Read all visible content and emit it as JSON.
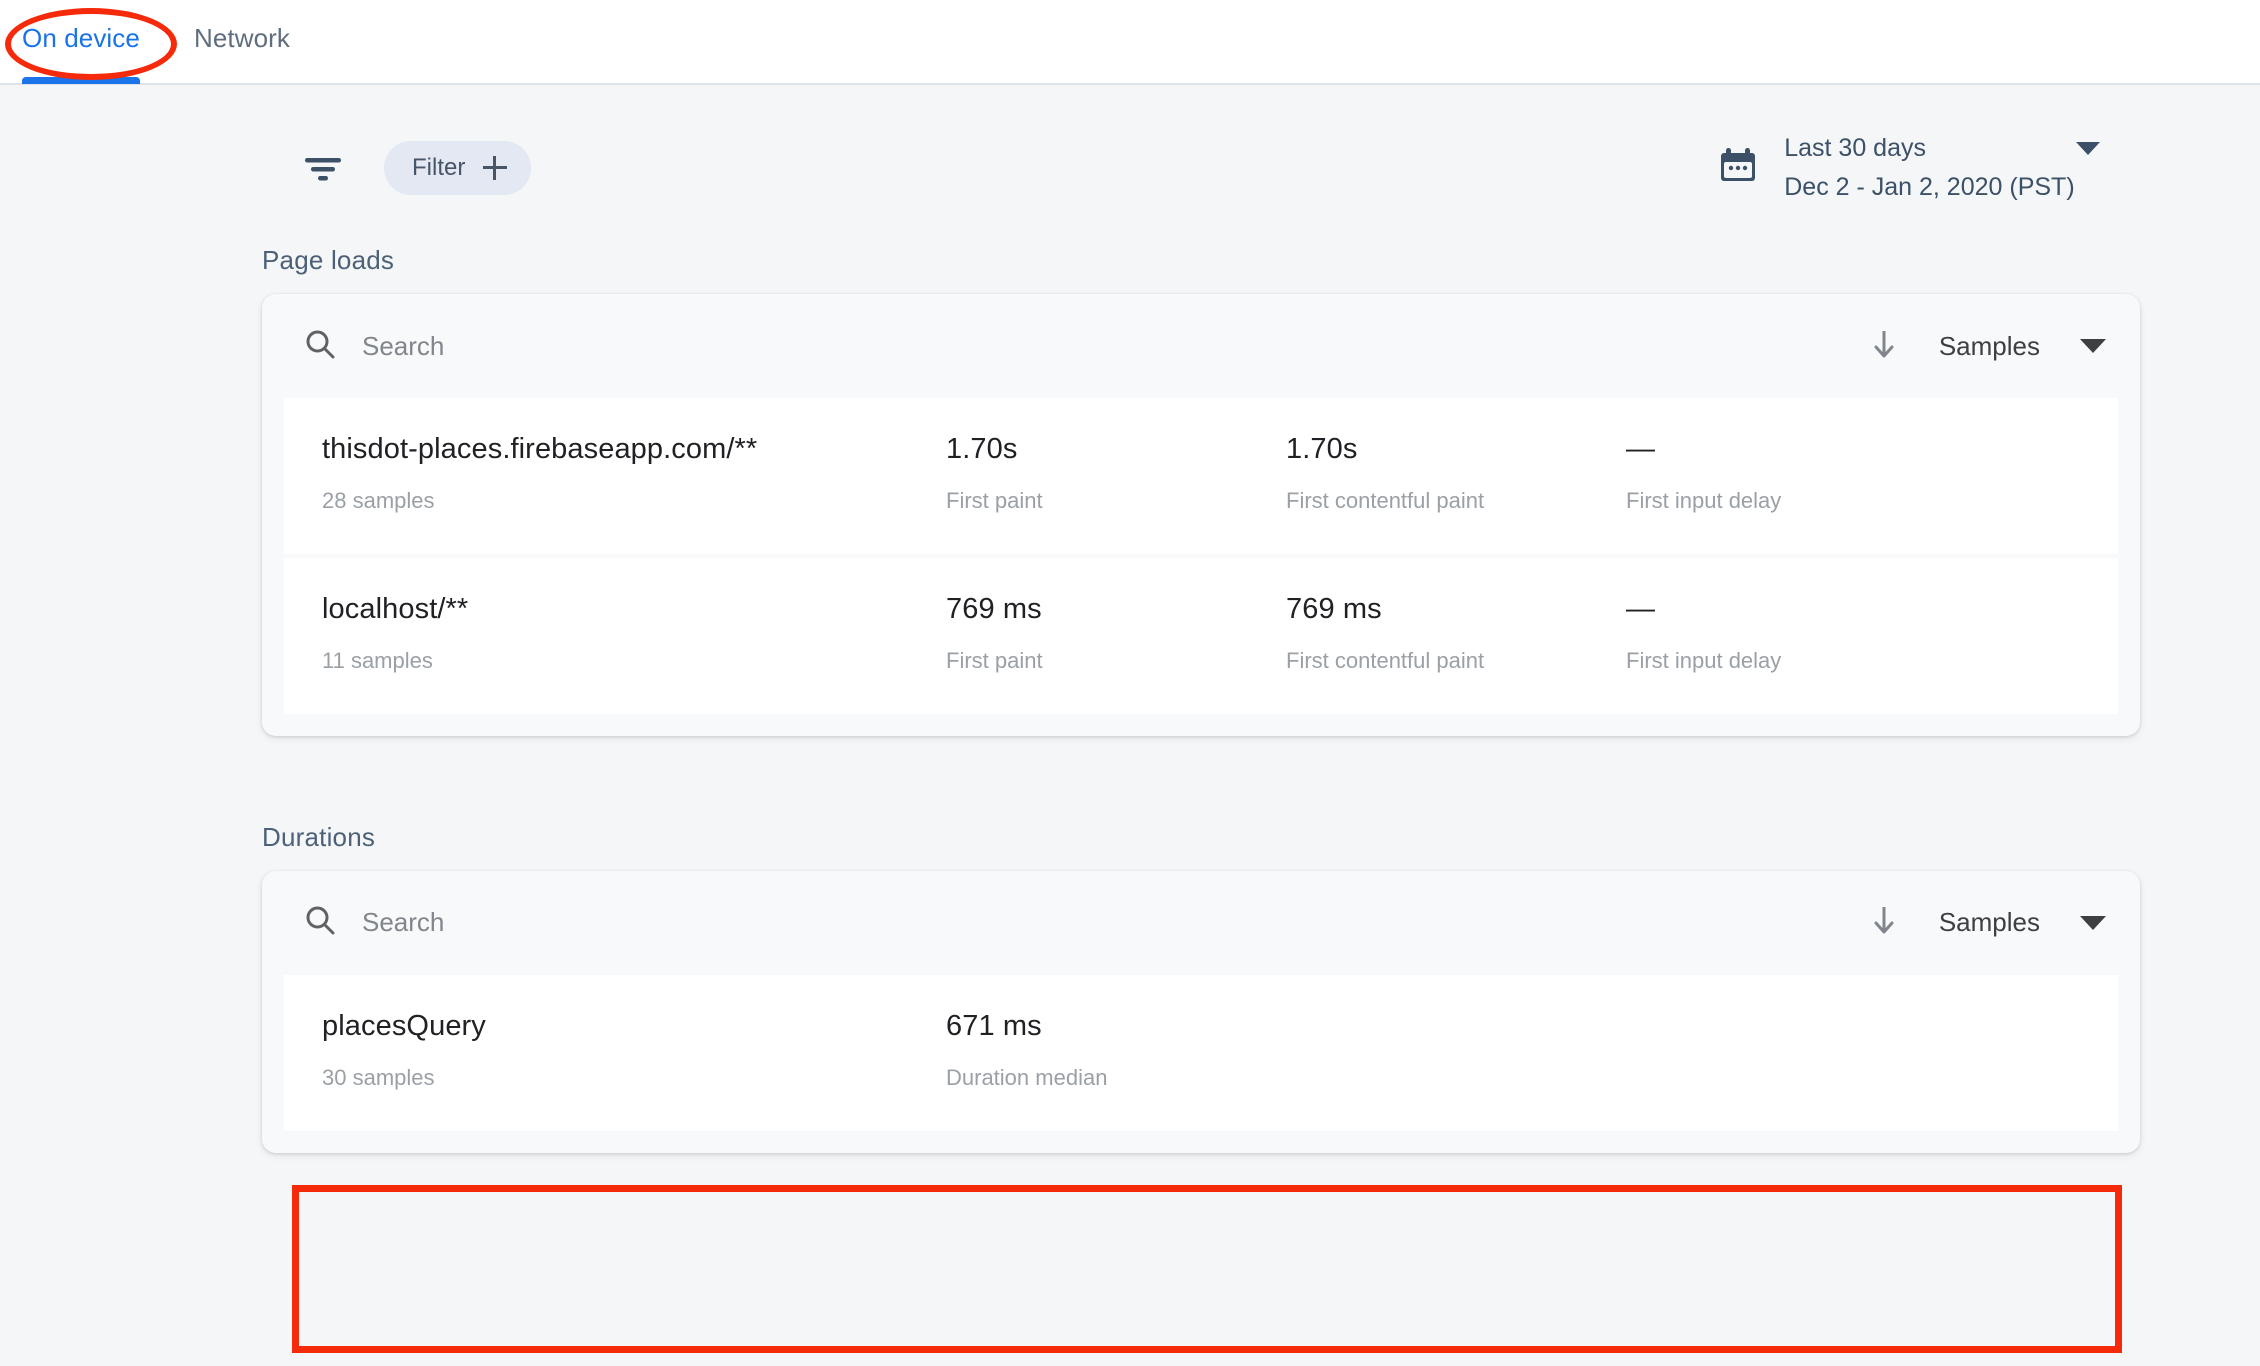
{
  "tabs": [
    {
      "label": "On device",
      "active": true
    },
    {
      "label": "Network",
      "active": false
    }
  ],
  "toolbar": {
    "filter_icon": "filter-lines-icon",
    "filter_chip_label": "Filter",
    "date_range_label": "Last 30 days",
    "date_range_value": "Dec 2 - Jan 2, 2020 (PST)",
    "calendar_icon": "calendar-icon",
    "dropdown_icon": "chevron-down-icon"
  },
  "sections": [
    {
      "title": "Page loads",
      "search_placeholder": "Search",
      "search_value": "",
      "search_icon": "search-icon",
      "sort_direction_icon": "arrow-down-icon",
      "sort_label": "Samples",
      "sort_caret_icon": "caret-down-icon",
      "rows": [
        {
          "name": "thisdot-places.firebaseapp.com/**",
          "samples": "28 samples",
          "metrics": [
            {
              "value": "1.70s",
              "label": "First paint"
            },
            {
              "value": "1.70s",
              "label": "First contentful paint"
            },
            {
              "value": "—",
              "label": "First input delay"
            }
          ]
        },
        {
          "name": "localhost/**",
          "samples": "11 samples",
          "metrics": [
            {
              "value": "769 ms",
              "label": "First paint"
            },
            {
              "value": "769 ms",
              "label": "First contentful paint"
            },
            {
              "value": "—",
              "label": "First input delay"
            }
          ]
        }
      ]
    },
    {
      "title": "Durations",
      "search_placeholder": "Search",
      "search_value": "",
      "search_icon": "search-icon",
      "sort_direction_icon": "arrow-down-icon",
      "sort_label": "Samples",
      "sort_caret_icon": "caret-down-icon",
      "rows": [
        {
          "name": "placesQuery",
          "samples": "30 samples",
          "metrics": [
            {
              "value": "671 ms",
              "label": "Duration median"
            }
          ]
        }
      ]
    }
  ],
  "annotations": {
    "color": "#f52a0b",
    "ellipse_target": "On device",
    "rect_target": "placesQuery"
  }
}
